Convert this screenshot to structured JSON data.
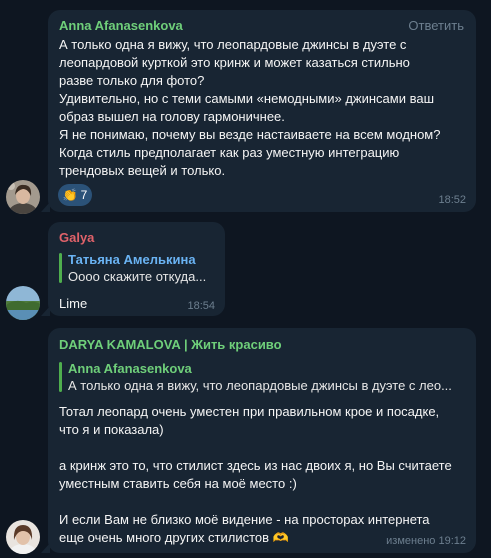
{
  "colors": {
    "background": "#0e1621",
    "bubble": "#182533",
    "anna": "#6fcf7a",
    "galya": "#e0626a",
    "darya": "#6fcf7a",
    "reply_bar": "#4fae4e",
    "link_blue": "#6ab3f3",
    "time": "#6d7f8f"
  },
  "messages": [
    {
      "sender": "Anna Afanasenkova",
      "action": "Ответить",
      "text": "А только одна я вижу, что леопардовые джинсы в дуэте с\nлеопардовой курткой это кринж и может казаться стильно\nразве только для фото?\nУдивительно, но с теми самыми «немодными» джинсами ваш\nобраз вышел на голову гармоничнее.\nЯ не понимаю, почему вы везде настаиваете на всем модном?\nКогда стиль предполагает как раз уместную интеграцию\nтрендовых вещей и только.",
      "reaction_icon": "clapping-hands-icon",
      "reaction_count": "7",
      "time": "18:52"
    },
    {
      "sender": "Galya",
      "reply_name": "Татьяна Амелькина",
      "reply_text": "Оооо скажите откуда...",
      "text": "Lime",
      "time": "18:54"
    },
    {
      "sender": "DARYA KAMALOVA | Жить красиво",
      "reply_name": "Anna Afanasenkova",
      "reply_text": "А только одна я вижу, что леопардовые джинсы в дуэте с лео...",
      "text": "Тотал леопард очень уместен при правильном крое и посадке,\nчто я и показала)\n\nа кринж это то, что стилист здесь из нас двоих я, но Вы считаете\nуместным ставить себя на моё место :)\n\nИ если Вам не близко моё видение - на просторах интернета\nеще очень много других стилистов 🫶",
      "time": "изменено 19:12"
    }
  ]
}
